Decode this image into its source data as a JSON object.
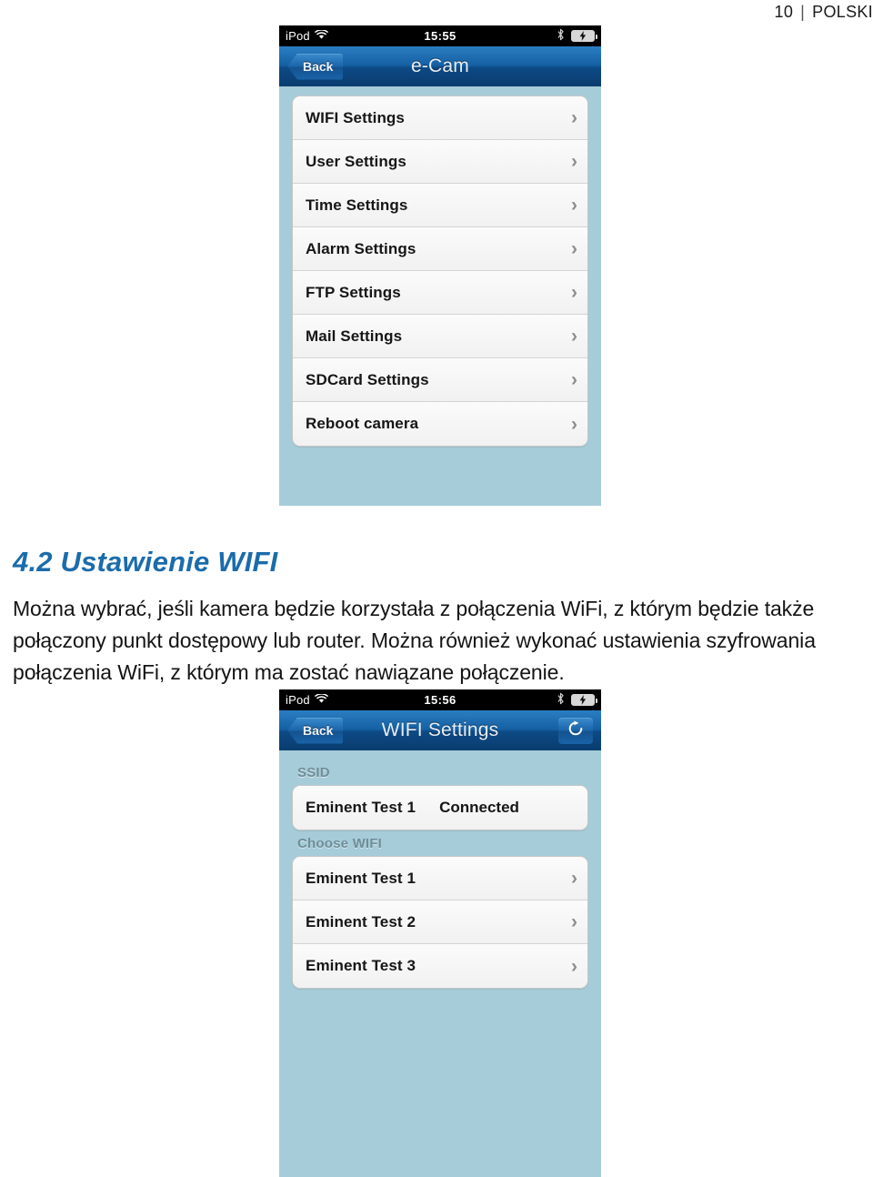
{
  "page_header": {
    "page_number": "10",
    "separator": "|",
    "language": "POLSKI"
  },
  "document": {
    "heading": "4.2 Ustawienie WIFI",
    "paragraph": "Można wybrać, jeśli kamera będzie korzystała z połączenia WiFi, z którym będzie także połączony punkt dostępowy lub router. Można również wykonać ustawienia szyfrowania połączenia WiFi, z którym ma zostać nawiązane połączenie."
  },
  "screenshot_1": {
    "statusbar": {
      "carrier": "iPod",
      "wifi_icon": "wifi-icon",
      "time": "15:55",
      "bluetooth_icon": "bluetooth-icon",
      "battery_icon": "battery-charging-icon"
    },
    "navbar": {
      "back_label": "Back",
      "title": "e-Cam"
    },
    "menu_items": [
      {
        "label": "WIFI Settings"
      },
      {
        "label": "User Settings"
      },
      {
        "label": "Time Settings"
      },
      {
        "label": "Alarm Settings"
      },
      {
        "label": "FTP Settings"
      },
      {
        "label": "Mail Settings"
      },
      {
        "label": "SDCard Settings"
      },
      {
        "label": "Reboot camera"
      }
    ],
    "chevron": "›"
  },
  "screenshot_2": {
    "statusbar": {
      "carrier": "iPod",
      "wifi_icon": "wifi-icon",
      "time": "15:56",
      "bluetooth_icon": "bluetooth-icon",
      "battery_icon": "battery-charging-icon"
    },
    "navbar": {
      "back_label": "Back",
      "title": "WIFI Settings",
      "refresh_icon": "refresh-icon"
    },
    "ssid_section": {
      "header": "SSID",
      "network_name": "Eminent Test 1",
      "status": "Connected"
    },
    "choose_wifi_section": {
      "header": "Choose WIFI",
      "networks": [
        {
          "label": "Eminent Test 1"
        },
        {
          "label": "Eminent Test 2"
        },
        {
          "label": "Eminent Test 3"
        }
      ]
    },
    "chevron": "›"
  },
  "colors": {
    "heading_blue": "#1b6cab",
    "phone_background": "#a6ccd9",
    "navbar_blue": "#1560a3",
    "statusbar_black": "#000000",
    "group_header_gray": "#6f8d99"
  }
}
